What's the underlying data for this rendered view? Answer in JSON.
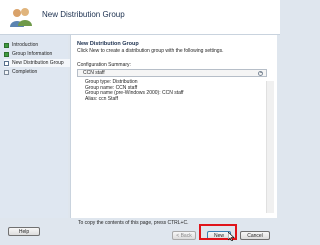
{
  "header": {
    "title": "New Distribution Group"
  },
  "sidebar": {
    "steps": [
      {
        "label": "Introduction",
        "status": "done"
      },
      {
        "label": "Group Information",
        "status": "done"
      },
      {
        "label": "New Distribution Group",
        "status": "current"
      },
      {
        "label": "Completion",
        "status": "pending"
      }
    ]
  },
  "main": {
    "title": "New Distribution Group",
    "description": "Click New to create a distribution group with the following settings.",
    "summary_label": "Configuration Summary:",
    "summary_name": "CCN staff",
    "details": [
      "Group type: Distribution",
      "Group name: CCN staff",
      "Group name (pre-Windows 2000): CCN staff",
      "Alias: ccn Staff"
    ]
  },
  "footer": {
    "copy_hint": "To copy the contents of this page, press CTRL+C.",
    "help_label": "Help",
    "back_label": "< Back",
    "new_label": "New",
    "cancel_label": "Cancel"
  },
  "colors": {
    "highlight": "#e0141b",
    "accent": "#3f9a3f"
  }
}
